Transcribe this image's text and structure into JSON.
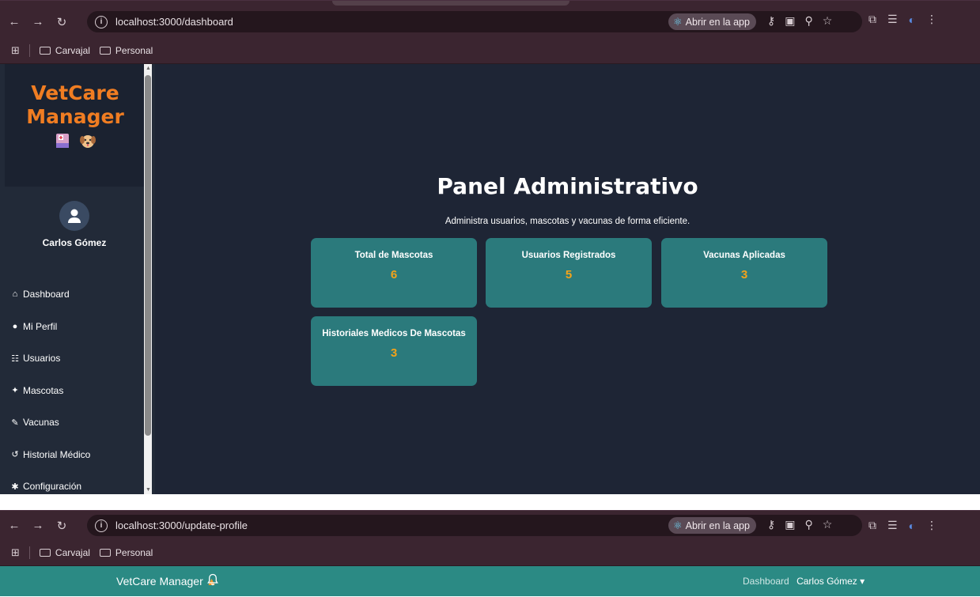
{
  "window1": {
    "url": "localhost:3000/dashboard",
    "open_app_label": "Abrir en la app",
    "bookmarks": [
      "Carvajal",
      "Personal"
    ],
    "sidebar": {
      "brand_line1": "VetCare",
      "brand_line2": "Manager",
      "user_name": "Carlos Gómez",
      "menu": [
        {
          "icon": "home-icon",
          "glyph": "⌂",
          "label": "Dashboard"
        },
        {
          "icon": "user-icon",
          "glyph": "●",
          "label": "Mi Perfil"
        },
        {
          "icon": "users-icon",
          "glyph": "☷",
          "label": "Usuarios"
        },
        {
          "icon": "pets-icon",
          "glyph": "✦",
          "label": "Mascotas"
        },
        {
          "icon": "syringe-icon",
          "glyph": "✎",
          "label": "Vacunas"
        },
        {
          "icon": "history-icon",
          "glyph": "↺",
          "label": "Historial Médico"
        },
        {
          "icon": "gear-icon",
          "glyph": "✱",
          "label": "Configuración"
        }
      ]
    },
    "main": {
      "title": "Panel Administrativo",
      "subtitle": "Administra usuarios, mascotas y vacunas de forma eficiente.",
      "cards": [
        {
          "title": "Total de Mascotas",
          "value": "6"
        },
        {
          "title": "Usuarios Registrados",
          "value": "5"
        },
        {
          "title": "Vacunas Aplicadas",
          "value": "3"
        },
        {
          "title": "Historiales Medicos De Mascotas",
          "value": "3"
        }
      ]
    }
  },
  "window2": {
    "url": "localhost:3000/update-profile",
    "open_app_label": "Abrir en la app",
    "bookmarks": [
      "Carvajal",
      "Personal"
    ],
    "navbar": {
      "brand": "VetCare Manager",
      "link_dashboard": "Dashboard",
      "user_menu": "Carlos Gómez ▾"
    }
  },
  "colors": {
    "brand_orange": "#f07d22",
    "card_teal": "#2b7a7c",
    "card_value": "#f3a31a",
    "main_bg": "#1e2535",
    "sidebar_bg": "#222a38",
    "navbar_teal": "#2b8a84",
    "chrome_bg": "#3b2530"
  }
}
